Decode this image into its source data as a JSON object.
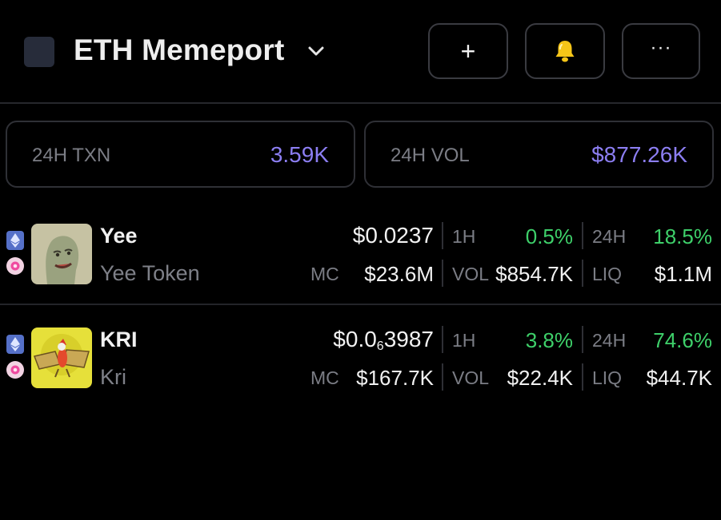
{
  "header": {
    "title": "ETH Memeport",
    "add_label": "+",
    "more_label": "···"
  },
  "stats": {
    "txn": {
      "label": "24H TXN",
      "value": "3.59K"
    },
    "vol": {
      "label": "24H VOL",
      "value": "$877.26K"
    }
  },
  "labels": {
    "h1": "1H",
    "h24": "24H",
    "mc": "MC",
    "vol": "VOL",
    "liq": "LIQ"
  },
  "tokens": [
    {
      "symbol": "Yee",
      "name": "Yee Token",
      "price": "$0.0237",
      "change_1h": "0.5%",
      "change_24h": "18.5%",
      "mc": "$23.6M",
      "vol": "$854.7K",
      "liq": "$1.1M",
      "chain_icon": "ethereum-icon",
      "dex_icon": "uniswap-icon"
    },
    {
      "symbol": "KRI",
      "name": "Kri",
      "price_prefix": "$0.0",
      "price_zeros": "6",
      "price_digits": "3987",
      "change_1h": "3.8%",
      "change_24h": "74.6%",
      "mc": "$167.7K",
      "vol": "$22.4K",
      "liq": "$44.7K",
      "chain_icon": "ethereum-icon",
      "dex_icon": "uniswap-icon"
    }
  ],
  "colors": {
    "background": "#000000",
    "accent_purple": "#8c7ef2",
    "positive_green": "#3ed06a",
    "muted_text": "#7b7d85",
    "border": "#2f3036",
    "bell_yellow": "#f5c518"
  }
}
